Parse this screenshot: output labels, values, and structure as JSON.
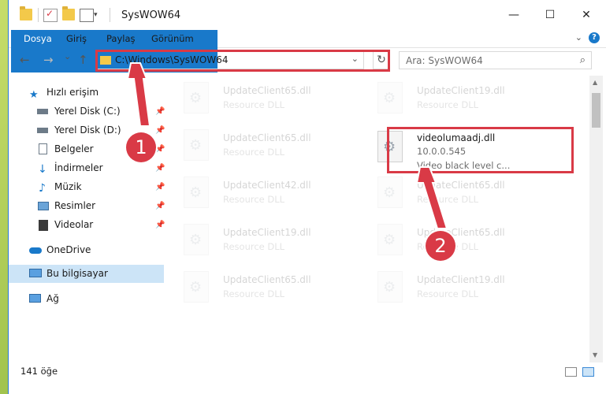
{
  "window": {
    "title": "SysWOW64",
    "minimize": "—",
    "maximize": "☐",
    "close": "✕"
  },
  "ribbon": {
    "tabs": [
      "Dosya",
      "Giriş",
      "Paylaş",
      "Görünüm"
    ],
    "help": "?"
  },
  "nav": {
    "back": "←",
    "forward": "→",
    "recent": "⌄",
    "up": "↑",
    "address": "C:\\Windows\\SysWOW64",
    "refresh": "↻",
    "search_placeholder": "Ara: SysWOW64"
  },
  "sidebar": {
    "items": [
      {
        "label": "Hızlı erişim",
        "icon": "star-icon"
      },
      {
        "label": "Yerel Disk (C:)",
        "icon": "drive-icon",
        "pinned": true
      },
      {
        "label": "Yerel Disk (D:)",
        "icon": "drive-icon",
        "pinned": true
      },
      {
        "label": "Belgeler",
        "icon": "documents-icon",
        "pinned": true
      },
      {
        "label": "İndirmeler",
        "icon": "download-icon",
        "pinned": true
      },
      {
        "label": "Müzik",
        "icon": "music-icon",
        "pinned": true
      },
      {
        "label": "Resimler",
        "icon": "pictures-icon",
        "pinned": true
      },
      {
        "label": "Videolar",
        "icon": "videos-icon",
        "pinned": true
      },
      {
        "label": "OneDrive",
        "icon": "cloud-icon"
      },
      {
        "label": "Bu bilgisayar",
        "icon": "computer-icon",
        "selected": true
      },
      {
        "label": "Ağ",
        "icon": "network-icon"
      }
    ]
  },
  "files": {
    "left_column": [
      {
        "name": "UpdateClient65.dll",
        "type": "Resource DLL"
      },
      {
        "name": "UpdateClient65.dll",
        "type": "Resource DLL"
      },
      {
        "name": "UpdateClient42.dll",
        "type": "Resource DLL"
      },
      {
        "name": "UpdateClient19.dll",
        "type": "Resource DLL"
      },
      {
        "name": "UpdateClient65.dll",
        "type": "Resource DLL"
      }
    ],
    "right_column": [
      {
        "name": "UpdateClient19.dll",
        "type": "Resource DLL"
      },
      {
        "name": "UpdateClient65.dll",
        "type": "Resource DLL"
      },
      {
        "name": "UpdateClient65.dll",
        "type": "Resource DLL"
      },
      {
        "name": "UpdateClient19.dll",
        "type": "Resource DLL"
      }
    ],
    "highlighted": {
      "name": "videolumaadj.dll",
      "version": "10.0.0.545",
      "description": "Video black level c..."
    }
  },
  "status": {
    "count": "141 öğe"
  },
  "callouts": [
    "1",
    "2"
  ],
  "colors": {
    "accent": "#1979ca",
    "highlight": "#d93a46",
    "selection": "#cce4f7"
  }
}
